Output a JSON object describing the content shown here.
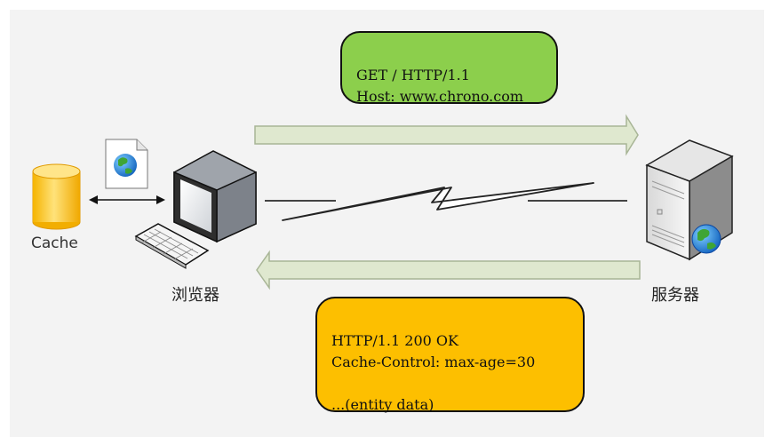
{
  "labels": {
    "cache": "Cache",
    "browser": "浏览器",
    "server": "服务器"
  },
  "request": {
    "line1": "GET / HTTP/1.1",
    "line2": "Host: www.chrono.com"
  },
  "response": {
    "line1": "HTTP/1.1 200 OK",
    "line2": "Cache-Control: max-age=30",
    "line3": "",
    "line4": "...(entity data)"
  },
  "colors": {
    "request_bubble": "#8ccf4c",
    "response_bubble": "#fdbf00",
    "arrow_fill": "#dfe8cf",
    "arrow_stroke": "#a8b596",
    "cache_body": "#ffc940"
  }
}
